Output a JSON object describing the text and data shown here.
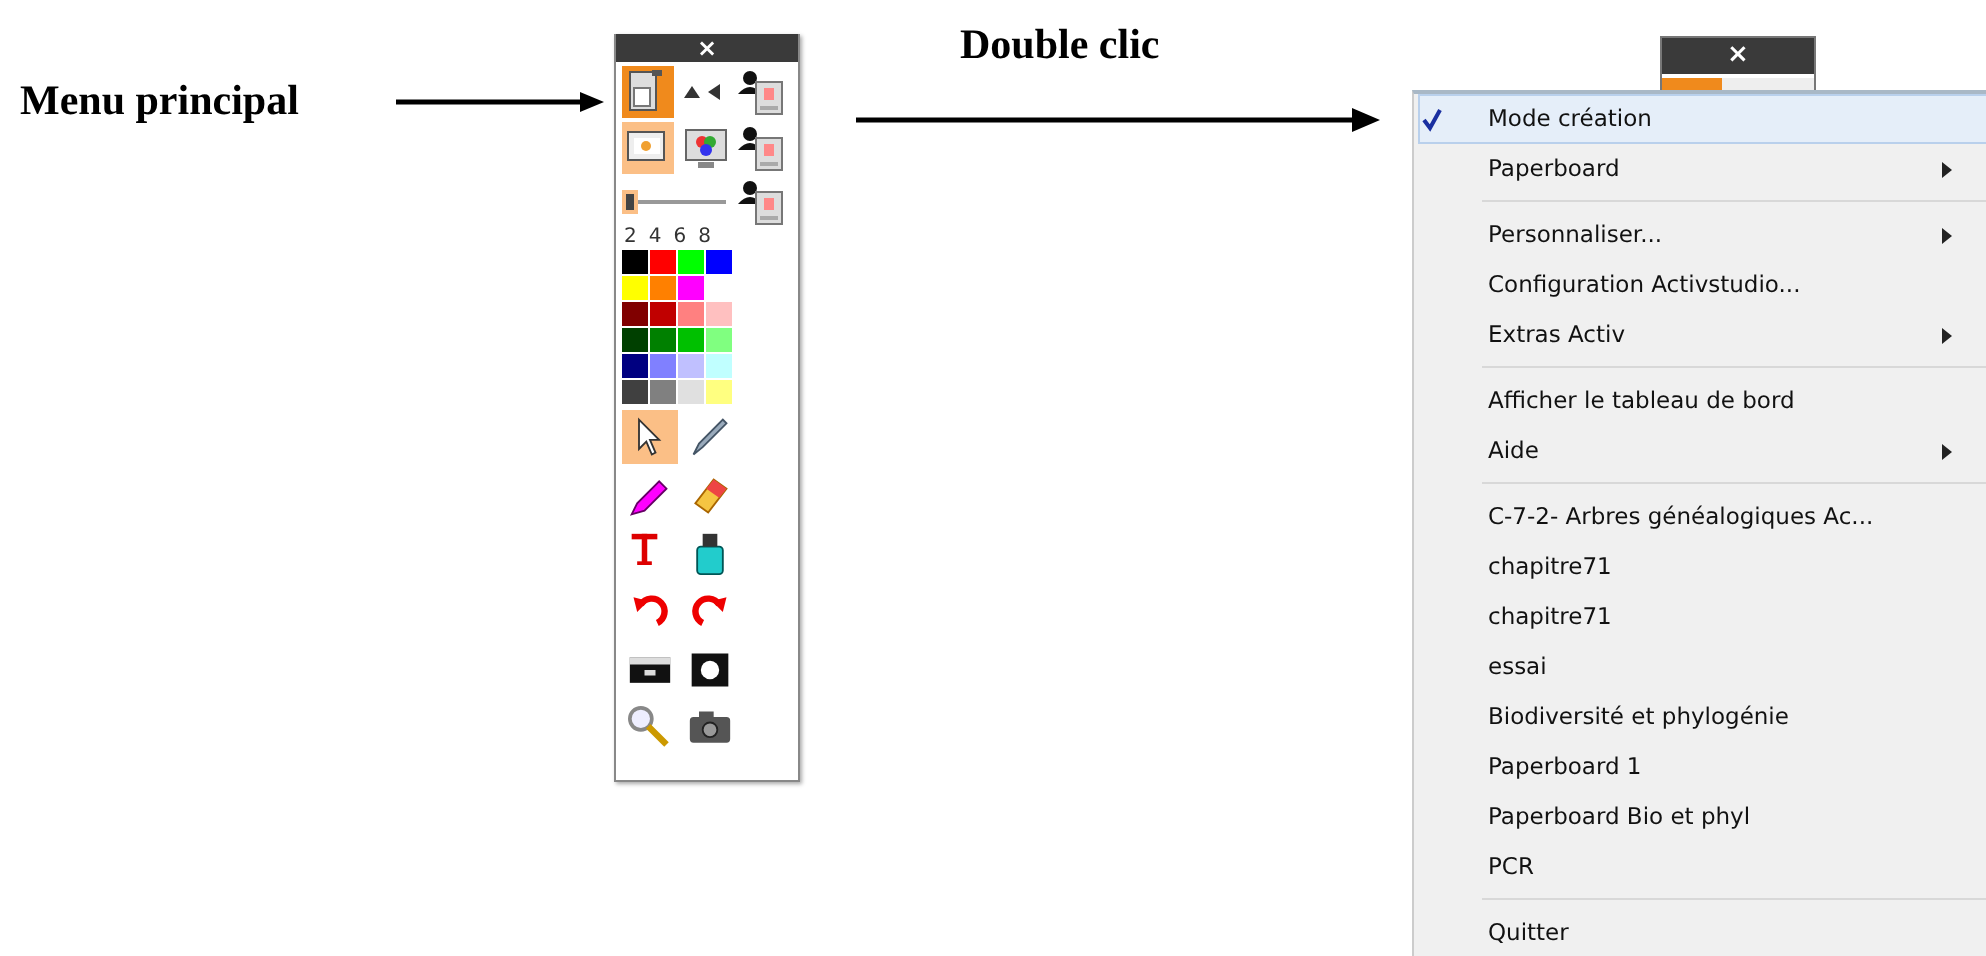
{
  "annotations": {
    "main_menu_label": "Menu principal",
    "double_click_label": "Double clic"
  },
  "toolbar": {
    "close": "×",
    "top_buttons": [
      {
        "kind": "mode",
        "selected": true
      },
      {
        "kind": "page",
        "selected": true
      },
      {
        "kind": "monitor",
        "selected": false
      }
    ],
    "thickness": {
      "level": 0.0
    },
    "pen_sizes": [
      "2",
      "4",
      "6",
      "8"
    ],
    "palette": [
      [
        {
          "color": "#000000"
        },
        {
          "color": "#ff0000"
        },
        {
          "color": "#00ff00"
        },
        {
          "color": "#0000ff"
        }
      ],
      [
        {
          "color": "#ffff00"
        },
        {
          "color": "#ff8000"
        },
        {
          "color": "#ff00ff"
        }
      ],
      [
        {
          "color": "#800000"
        },
        {
          "color": "#c00000"
        },
        {
          "color": "#ff8080"
        },
        {
          "color": "#ffc0c0"
        }
      ],
      [
        {
          "color": "#004000"
        },
        {
          "color": "#008000"
        },
        {
          "color": "#00c000"
        },
        {
          "color": "#80ff80"
        }
      ],
      [
        {
          "color": "#000080"
        },
        {
          "color": "#8080ff"
        },
        {
          "color": "#c0c0ff"
        },
        {
          "color": "#c0ffff"
        }
      ],
      [
        {
          "color": "#404040"
        },
        {
          "color": "#808080"
        },
        {
          "color": "#e0e0e0"
        },
        {
          "color": "#ffff80"
        }
      ]
    ],
    "tools": [
      {
        "kind": "pointer",
        "selected": true
      },
      {
        "kind": "pen",
        "selected": false
      },
      {
        "kind": "highlighter",
        "selected": false
      },
      {
        "kind": "eraser",
        "selected": false
      },
      {
        "kind": "text",
        "selected": false
      },
      {
        "kind": "spray",
        "selected": false
      },
      {
        "kind": "undo",
        "selected": false
      },
      {
        "kind": "redo",
        "selected": false
      },
      {
        "kind": "blind",
        "selected": false
      },
      {
        "kind": "spotlight",
        "selected": false
      },
      {
        "kind": "magnifier",
        "selected": false
      },
      {
        "kind": "camera",
        "selected": false
      }
    ]
  },
  "context_menu": {
    "close": "×",
    "items": [
      {
        "kind": "item",
        "label": "Mode création",
        "checked": true,
        "submenu": false
      },
      {
        "kind": "item",
        "label": "Paperboard",
        "checked": false,
        "submenu": true
      },
      {
        "kind": "separator"
      },
      {
        "kind": "item",
        "label": "Personnaliser...",
        "checked": false,
        "submenu": true
      },
      {
        "kind": "item",
        "label": "Configuration Activstudio...",
        "checked": false,
        "submenu": false
      },
      {
        "kind": "item",
        "label": "Extras Activ",
        "checked": false,
        "submenu": true
      },
      {
        "kind": "separator"
      },
      {
        "kind": "item",
        "label": "Afficher le tableau de bord",
        "checked": false,
        "submenu": false
      },
      {
        "kind": "item",
        "label": "Aide",
        "checked": false,
        "submenu": true
      },
      {
        "kind": "separator"
      },
      {
        "kind": "item",
        "label": "C-7-2- Arbres généalogiques Ac...",
        "checked": false,
        "submenu": false
      },
      {
        "kind": "item",
        "label": "chapitre71",
        "checked": false,
        "submenu": false
      },
      {
        "kind": "item",
        "label": "chapitre71",
        "checked": false,
        "submenu": false
      },
      {
        "kind": "item",
        "label": "essai",
        "checked": false,
        "submenu": false
      },
      {
        "kind": "item",
        "label": "Biodiversité et phylogénie",
        "checked": false,
        "submenu": false
      },
      {
        "kind": "item",
        "label": "Paperboard 1",
        "checked": false,
        "submenu": false
      },
      {
        "kind": "item",
        "label": "Paperboard Bio et phyl",
        "checked": false,
        "submenu": false
      },
      {
        "kind": "item",
        "label": "PCR",
        "checked": false,
        "submenu": false
      },
      {
        "kind": "separator"
      },
      {
        "kind": "item",
        "label": "Quitter",
        "checked": false,
        "submenu": false
      }
    ]
  }
}
